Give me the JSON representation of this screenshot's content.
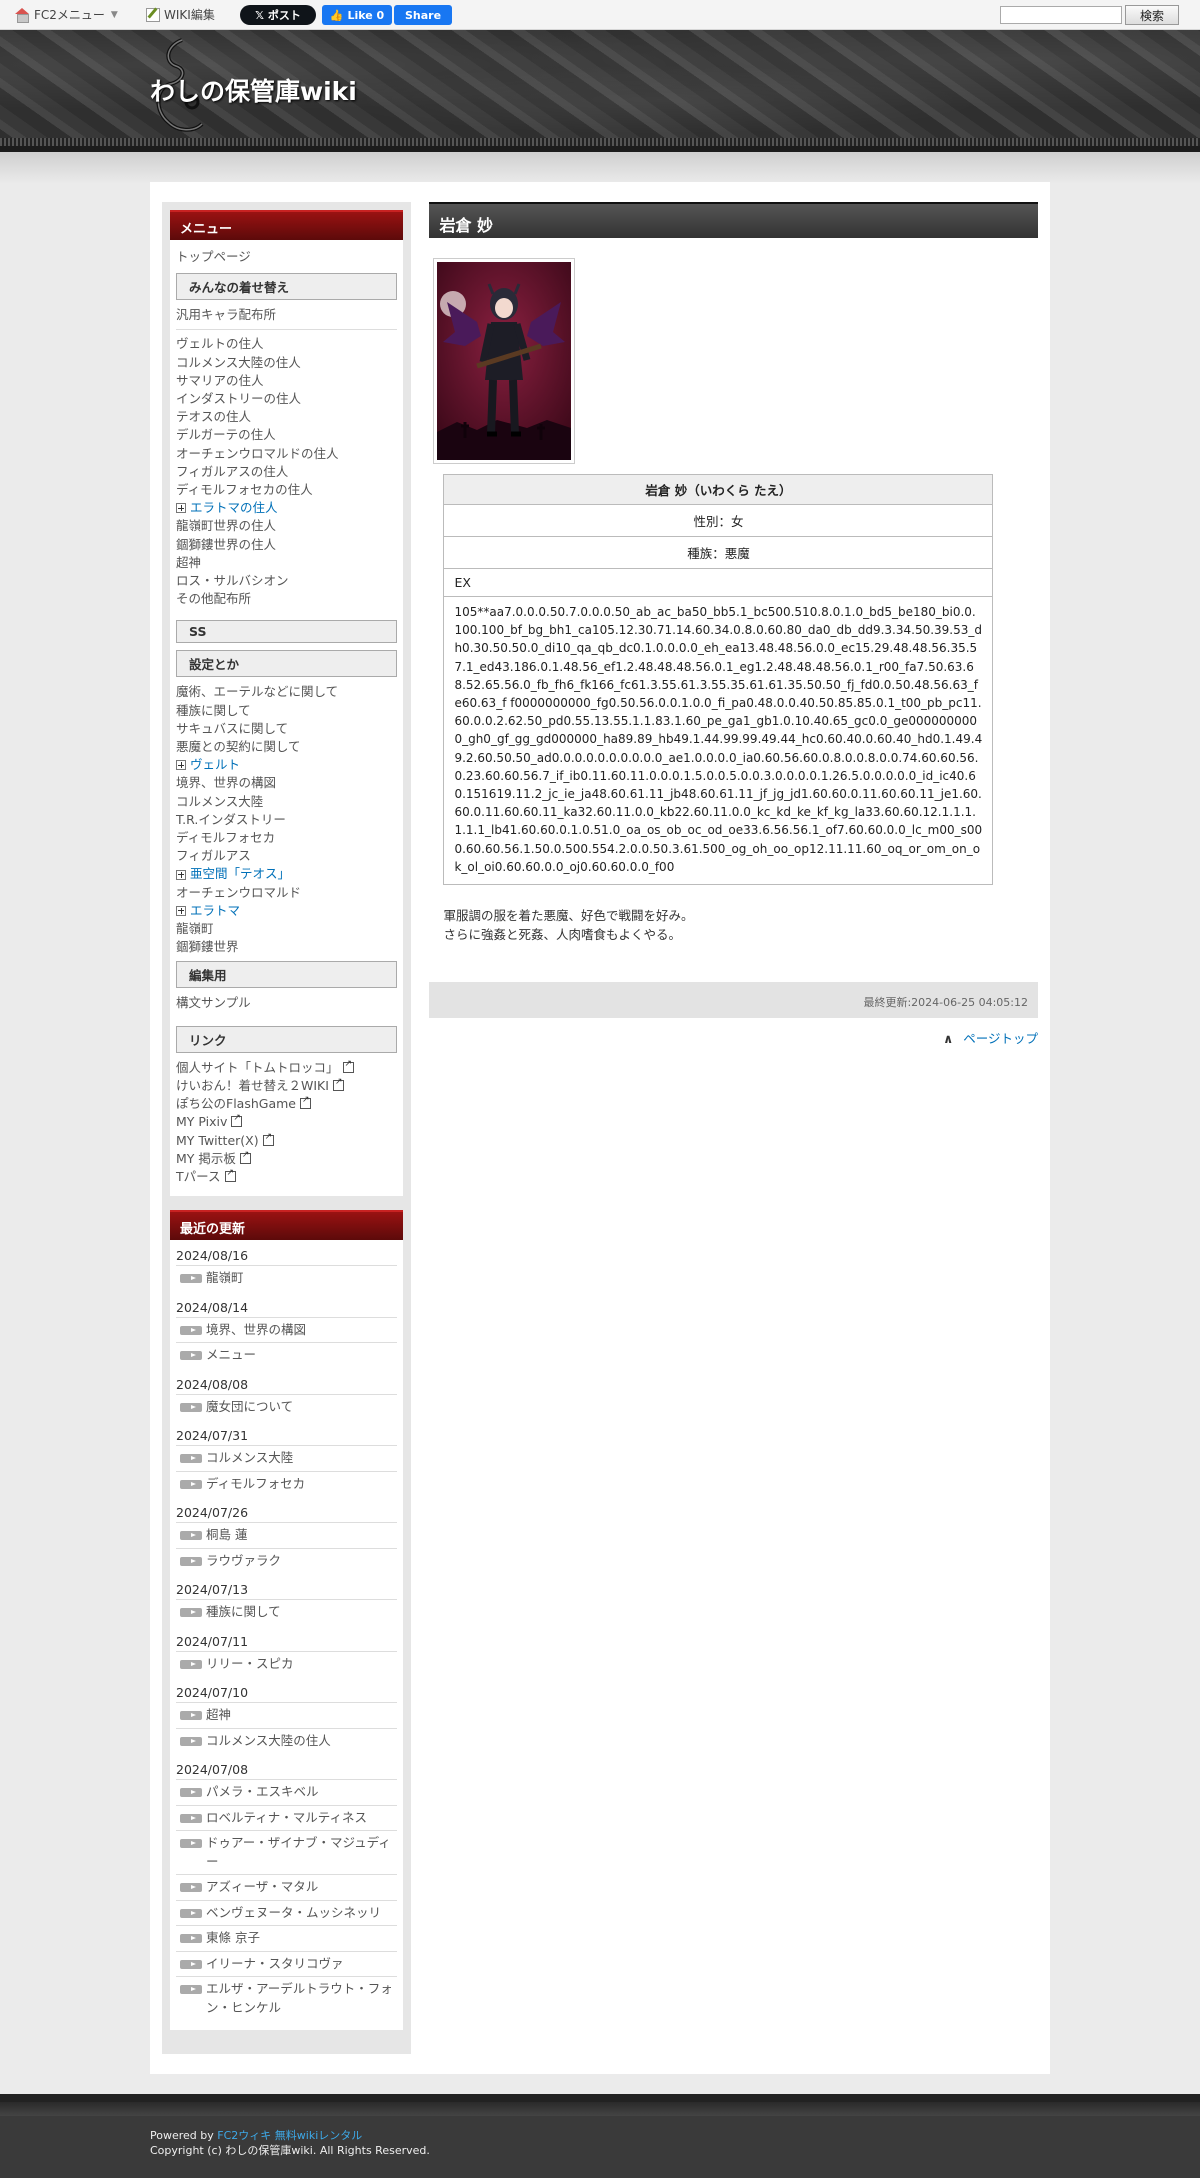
{
  "fc2bar": {
    "menu_label": "FC2メニュー",
    "wiki_edit": "WIKI編集",
    "x_post": "𝕏 ポスト",
    "fb_like": "Like 0",
    "fb_share": "Share",
    "search_button": "検索"
  },
  "header": {
    "site_title": "わしの保管庫wiki"
  },
  "sidebar": {
    "menu_title": "メニュー",
    "top_page": "トップページ",
    "section_dressup": "みんなの着せ替え",
    "generic_dist": "汎用キャラ配布所",
    "residents": [
      "ヴェルトの住人",
      "コルメンス大陸の住人",
      "サマリアの住人",
      "インダストリーの住人",
      "テオスの住人",
      "デルガーテの住人",
      "オーチェンウロマルドの住人",
      "フィガルアスの住人",
      "ディモルフォセカの住人"
    ],
    "eratoma_residents": "エラトマの住人",
    "residents2": [
      "龍嶺町世界の住人",
      "錮獅鏤世界の住人",
      "超神",
      "ロス・サルバシオン",
      "その他配布所"
    ],
    "section_ss": "SS",
    "section_settings": "設定とか",
    "settings1": [
      "魔術、エーテルなどに関して",
      "種族に関して",
      "サキュバスに関して",
      "悪魔との契約に関して"
    ],
    "velt": "ヴェルト",
    "settings2": [
      "境界、世界の構図",
      "コルメンス大陸",
      "T.R.インダストリー",
      "ディモルフォセカ",
      "フィガルアス"
    ],
    "teos": "亜空間「テオス」",
    "ochen": "オーチェンウロマルド",
    "eratoma": "エラトマ",
    "settings3": [
      "龍嶺町",
      "錮獅鏤世界"
    ],
    "section_edit": "編集用",
    "syntax_sample": "構文サンプル",
    "section_links": "リンク",
    "links": [
      "個人サイト「トムトロッコ」",
      "けいおん！着せ替え２WIKI",
      "ぽち公のFlashGame",
      "MY Pixiv",
      "MY Twitter(X)",
      "MY 掲示板",
      "Tパース"
    ],
    "recent_title": "最近の更新",
    "recent": [
      {
        "date": "2024/08/16",
        "items": [
          "龍嶺町"
        ]
      },
      {
        "date": "2024/08/14",
        "items": [
          "境界、世界の構図",
          "メニュー"
        ]
      },
      {
        "date": "2024/08/08",
        "items": [
          "魔女団について"
        ]
      },
      {
        "date": "2024/07/31",
        "items": [
          "コルメンス大陸",
          "ディモルフォセカ"
        ]
      },
      {
        "date": "2024/07/26",
        "items": [
          "桐島 蓮",
          "ラウヴァラク"
        ]
      },
      {
        "date": "2024/07/13",
        "items": [
          "種族に関して"
        ]
      },
      {
        "date": "2024/07/11",
        "items": [
          "リリー・スピカ"
        ]
      },
      {
        "date": "2024/07/10",
        "items": [
          "超神",
          "コルメンス大陸の住人"
        ]
      },
      {
        "date": "2024/07/08",
        "items": [
          "パメラ・エスキベル",
          "ロベルティナ・マルティネス",
          "ドゥアー・ザイナブ・マジュディー",
          "アズィーザ・マタル",
          "ベンヴェヌータ・ムッシネッリ",
          "東條 京子",
          "イリーナ・スタリコヴァ",
          "エルザ・アーデルトラウト・フォン・ヒンケル"
        ]
      }
    ]
  },
  "main": {
    "page_title": "岩倉 妙",
    "table": {
      "name": "岩倉 妙（いわくら たえ）",
      "gender": "性別：女",
      "race": "種族：悪魔",
      "ex_label": "EX",
      "code": "105**aa7.0.0.0.50.7.0.0.0.50_ab_ac_ba50_bb5.1_bc500.510.8.0.1.0_bd5_be180_bi0.0.100.100_bf_bg_bh1_ca105.12.30.71.14.60.34.0.8.0.60.80_da0_db_dd9.3.34.50.39.53_dh0.30.50.50.0_di10_qa_qb_dc0.1.0.0.0.0_eh_ea13.48.48.56.0.0_ec15.29.48.48.56.35.57.1_ed43.186.0.1.48.56_ef1.2.48.48.48.56.0.1_eg1.2.48.48.48.56.0.1_r00_fa7.50.63.68.52.65.56.0_fb_fh6_fk166_fc61.3.55.61.3.55.35.61.61.35.50.50_fj_fd0.0.50.48.56.63_fe60.63_f f0000000000_fg0.50.56.0.0.1.0.0_fi_pa0.48.0.0.40.50.85.85.0.1_t00_pb_pc11.60.0.0.2.62.50_pd0.55.13.55.1.1.83.1.60_pe_ga1_gb1.0.10.40.65_gc0.0_ge0000000000_gh0_gf_gg_gd000000_ha89.89_hb49.1.44.99.99.49.44_hc0.60.40.0.60.40_hd0.1.49.49.2.60.50.50_ad0.0.0.0.0.0.0.0.0.0_ae1.0.0.0.0_ia0.60.56.60.0.8.0.0.8.0.0.74.60.60.56.0.23.60.60.56.7_if_ib0.11.60.11.0.0.0.1.5.0.0.5.0.0.3.0.0.0.0.1.26.5.0.0.0.0.0_id_ic40.60.151619.11.2_jc_ie_ja48.60.61.11_jb48.60.61.11_jf_jg_jd1.60.60.0.11.60.60.11_je1.60.60.0.11.60.60.11_ka32.60.11.0.0_kb22.60.11.0.0_kc_kd_ke_kf_kg_la33.60.60.12.1.1.1.1.1.1_lb41.60.60.0.1.0.51.0_oa_os_ob_oc_od_oe33.6.56.56.1_of7.60.60.0.0_lc_m00_s000.60.60.56.1.50.0.500.554.2.0.0.50.3.61.500_og_oh_oo_op12.11.11.60_oq_or_om_on_ok_ol_oi0.60.60.0.0_oj0.60.60.0.0_f00"
    },
    "description_1": "軍服調の服を着た悪魔、好色で戦闘を好み。",
    "description_2": "さらに強姦と死姦、人肉嗜食もよくやる。",
    "last_updated": "最終更新:2024-06-25 04:05:12",
    "page_top": "ページトップ"
  },
  "footer": {
    "powered_by": "Powered by ",
    "powered_link": "FC2ウィキ 無料wikiレンタル",
    "copyright": "Copyright (c) わしの保管庫wiki. All Rights Reserved."
  }
}
